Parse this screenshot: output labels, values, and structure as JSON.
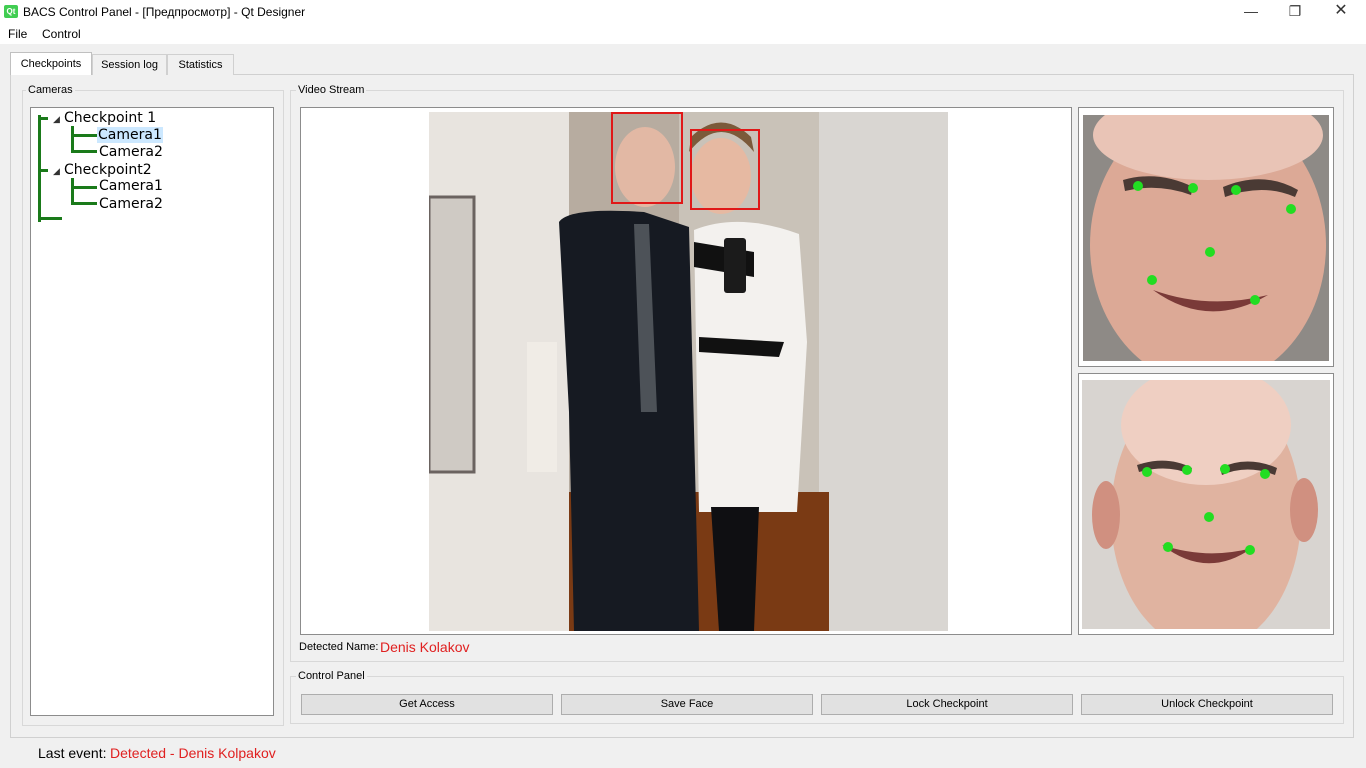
{
  "window": {
    "title": "BACS Control Panel - [Предпросмотр] - Qt Designer",
    "icon_text": "Qt",
    "min": "—",
    "max": "❐",
    "close": "✕"
  },
  "menu": {
    "file": "File",
    "control": "Control"
  },
  "tabs": [
    {
      "label": "Checkpoints",
      "active": true
    },
    {
      "label": "Session log",
      "active": false
    },
    {
      "label": "Statistics",
      "active": false
    }
  ],
  "cameras": {
    "group_title": "Cameras",
    "tree": [
      {
        "label": "Checkpoint 1",
        "children": [
          "Camera1",
          "Camera2"
        ]
      },
      {
        "label": "Checkpoint2",
        "children": [
          "Camera1",
          "Camera2"
        ]
      }
    ],
    "selected": "Checkpoint 1 / Camera1"
  },
  "video": {
    "group_title": "Video Stream",
    "detected_label": "Detected Name:",
    "detected_name": "Denis Kolakov",
    "box_color": "#e01818",
    "landmark_color": "#22dd22"
  },
  "control_panel": {
    "group_title": "Control Panel",
    "buttons": [
      "Get Access",
      "Save Face",
      "Lock Checkpoint",
      "Unlock Checkpoint"
    ]
  },
  "status": {
    "label": "Last event:",
    "value": "Detected - Denis Kolpakov"
  }
}
